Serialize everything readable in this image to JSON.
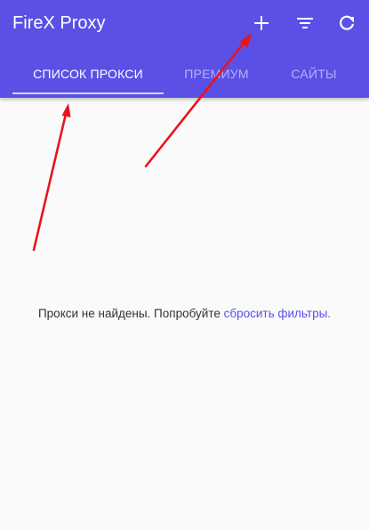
{
  "header": {
    "title": "FireX Proxy",
    "actions": [
      {
        "name": "add",
        "icon": "plus-icon"
      },
      {
        "name": "filter",
        "icon": "filter-icon"
      },
      {
        "name": "refresh",
        "icon": "refresh-icon"
      }
    ]
  },
  "tabs": [
    {
      "label": "СПИСОК ПРОКСИ",
      "active": true
    },
    {
      "label": "ПРЕМИУМ",
      "active": false
    },
    {
      "label": "САЙТЫ",
      "active": false
    }
  ],
  "main": {
    "empty_text": "Прокси не найдены. Попробуйте",
    "reset_link": "сбросить фильтры."
  },
  "colors": {
    "accent": "#5a50e6",
    "background": "#fafafa",
    "annotation_arrow": "#e8141c"
  }
}
